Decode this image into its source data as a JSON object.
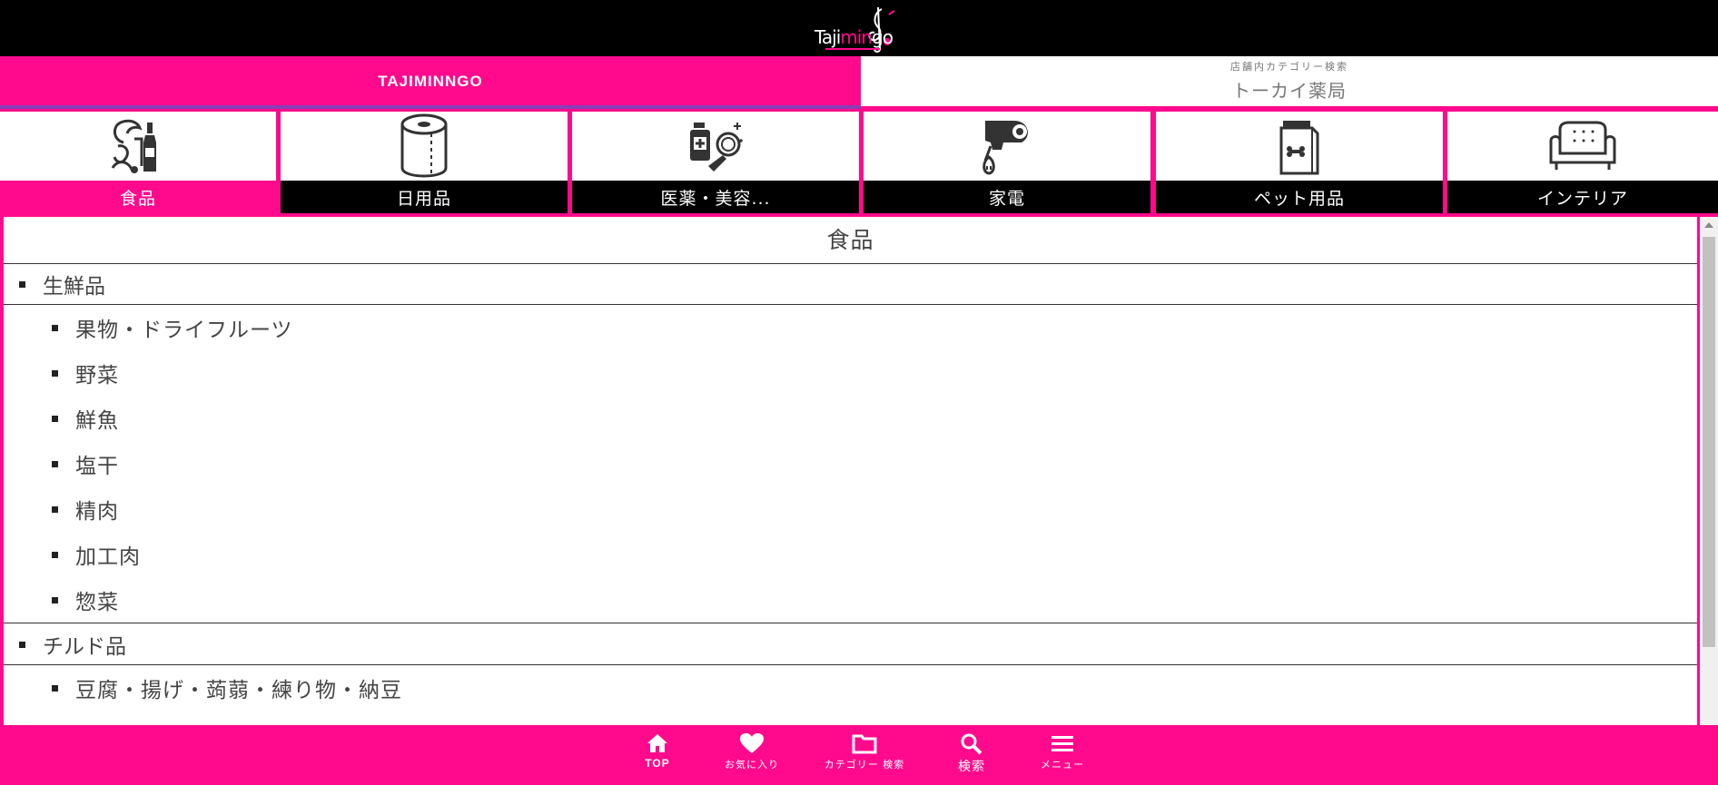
{
  "header": {
    "logo_text_a": "Taji",
    "logo_text_b": "min",
    "logo_text_c": "go"
  },
  "store_tabs": {
    "active_label": "TAJIMINNGO",
    "caption": "店舗内カテゴリー検索",
    "store_name": "トーカイ薬局"
  },
  "categories": [
    {
      "label": "食品",
      "icon": "food-icon"
    },
    {
      "label": "日用品",
      "icon": "toilet-paper-icon"
    },
    {
      "label": "医薬・美容...",
      "icon": "medicine-cosmetics-icon"
    },
    {
      "label": "家電",
      "icon": "hair-dryer-icon"
    },
    {
      "label": "ペット用品",
      "icon": "pet-food-bag-icon"
    },
    {
      "label": "インテリア",
      "icon": "sofa-icon"
    }
  ],
  "content": {
    "title": "食品",
    "sections": [
      {
        "heading": "生鮮品",
        "items": [
          "果物・ドライフルーツ",
          "野菜",
          "鮮魚",
          "塩干",
          "精肉",
          "加工肉",
          "惣菜"
        ]
      },
      {
        "heading": "チルド品",
        "items": [
          "豆腐・揚げ・蒟蒻・練り物・納豆"
        ]
      }
    ]
  },
  "bottom_nav": [
    {
      "label": "TOP",
      "icon": "home-icon"
    },
    {
      "label": "お気に入り",
      "icon": "heart-icon"
    },
    {
      "label": "カテゴリー 検索",
      "icon": "folder-icon"
    },
    {
      "label": "検索",
      "icon": "search-icon"
    },
    {
      "label": "メニュー",
      "icon": "menu-icon"
    }
  ],
  "colors": {
    "brand_pink": "#ff0a8c",
    "header_black": "#000000"
  }
}
